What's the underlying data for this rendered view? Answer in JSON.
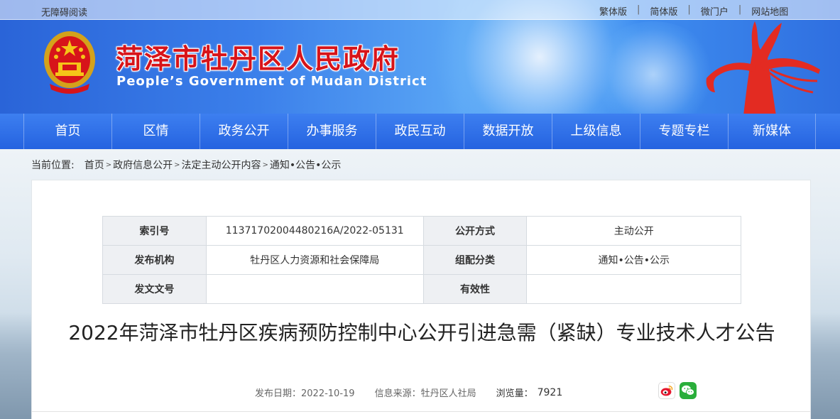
{
  "topbar": {
    "accessibility": "无障碍阅读",
    "links": [
      "繁体版",
      "简体版",
      "微门户",
      "网站地图"
    ]
  },
  "header": {
    "title": "菏泽市牡丹区人民政府",
    "subtitle": "People’s Government of Mudan District"
  },
  "nav": {
    "items": [
      "首页",
      "区情",
      "政务公开",
      "办事服务",
      "政民互动",
      "数据开放",
      "上级信息",
      "专题专栏",
      "新媒体"
    ]
  },
  "breadcrumb": {
    "label": "当前位置:",
    "items": [
      "首页",
      "政府信息公开",
      "法定主动公开内容",
      "通知•公告•公示"
    ]
  },
  "meta": {
    "index_label": "索引号",
    "index_value": "11371702004480216A/2022-05131",
    "open_mode_label": "公开方式",
    "open_mode_value": "主动公开",
    "publisher_label": "发布机构",
    "publisher_value": "牡丹区人力资源和社会保障局",
    "category_label": "组配分类",
    "category_value": "通知•公告•公示",
    "doc_no_label": "发文文号",
    "doc_no_value": "",
    "validity_label": "有效性",
    "validity_value": ""
  },
  "article": {
    "title": "2022年菏泽市牡丹区疾病预防控制中心公开引进急需（紧缺）专业技术人才公告",
    "date": "发布日期：2022-10-19",
    "source": "信息来源：牡丹区人社局",
    "views_label": "浏览量：",
    "views_value": "7921"
  },
  "icons": {
    "share_weibo": "weibo-icon",
    "share_wechat": "wechat-icon",
    "emblem": "national-emblem-icon"
  },
  "colors": {
    "brand_red": "#d7141a",
    "nav_blue": "#2563e0"
  }
}
